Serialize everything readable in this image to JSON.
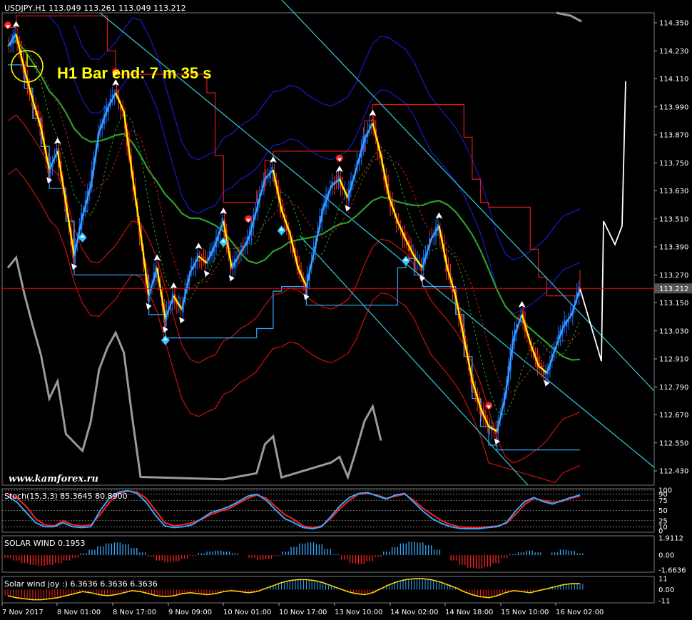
{
  "chart_title": "USDJPY,H1  113.049 113.261 113.049 113.212",
  "bar_end_label": "H1 Bar end: 7 m 35 s",
  "watermark": "www.kamforex.ru",
  "current_price_label": "113.212",
  "colors": {
    "background": "#000000",
    "up_candle": "#1e6fff",
    "down_candle": "#ff2a1a",
    "fast_line": "#ffff00",
    "mid_line": "#35a7ff",
    "green_ma": "#2ca02c",
    "envelope_blue": "#1a1acc",
    "envelope_red": "#cc1010",
    "trendline": "#33ccdd",
    "grey_band": "#9a9a9a",
    "current_price": "#ff0000",
    "histogram_pos": "#33aaff",
    "histogram_neg": "#ff2020"
  },
  "chart_data": [
    {
      "type": "line",
      "name_panel": "main",
      "ylim": [
        112.43,
        114.35
      ],
      "y_ticks": [
        "114.350",
        "114.230",
        "114.110",
        "113.990",
        "113.870",
        "113.750",
        "113.630",
        "113.510",
        "113.390",
        "113.270",
        "113.150",
        "113.030",
        "112.910",
        "112.790",
        "112.670",
        "112.550",
        "112.430"
      ],
      "current_price": 113.212,
      "x_ticks": [
        "7 Nov 2017",
        "8 Nov 01:00",
        "8 Nov 17:00",
        "9 Nov 09:00",
        "10 Nov 01:00",
        "10 Nov 17:00",
        "13 Nov 10:00",
        "14 Nov 02:00",
        "14 Nov 18:00",
        "15 Nov 10:00",
        "16 Nov 02:00"
      ],
      "price_path": [
        114.25,
        114.3,
        114.15,
        114.02,
        113.9,
        113.72,
        113.8,
        113.58,
        113.35,
        113.52,
        113.65,
        113.88,
        113.98,
        114.05,
        113.97,
        113.7,
        113.45,
        113.18,
        113.3,
        113.08,
        113.18,
        113.12,
        113.28,
        113.35,
        113.32,
        113.4,
        113.5,
        113.3,
        113.36,
        113.42,
        113.55,
        113.68,
        113.72,
        113.55,
        113.45,
        113.3,
        113.22,
        113.38,
        113.55,
        113.65,
        113.68,
        113.6,
        113.72,
        113.85,
        113.92,
        113.78,
        113.6,
        113.5,
        113.42,
        113.35,
        113.3,
        113.42,
        113.48,
        113.3,
        113.18,
        113.0,
        112.82,
        112.7,
        112.62,
        112.6,
        112.75,
        113.0,
        113.1,
        112.98,
        112.88,
        112.85,
        112.95,
        113.05,
        113.1,
        113.212
      ],
      "annotation": "www.kamforex.ru"
    },
    {
      "type": "line",
      "panel": "stochastic",
      "label": "Stoch(15,3,3) 85.3645 80.8900",
      "ylim": [
        0,
        100
      ],
      "y_ticks": [
        "100",
        "90",
        "75",
        "50",
        "25",
        "10",
        "0"
      ],
      "series": [
        {
          "color": "#ff2020",
          "values": [
            90,
            80,
            60,
            30,
            15,
            12,
            25,
            15,
            12,
            15,
            40,
            70,
            92,
            98,
            95,
            80,
            50,
            20,
            12,
            15,
            20,
            28,
            40,
            48,
            55,
            68,
            80,
            88,
            80,
            60,
            40,
            28,
            12,
            8,
            12,
            30,
            55,
            75,
            90,
            92,
            88,
            80,
            85,
            90,
            75,
            55,
            40,
            25,
            15,
            10,
            8,
            8,
            10,
            12,
            18,
            40,
            65,
            80,
            75,
            70,
            72,
            80,
            85
          ]
        },
        {
          "color": "#35a7ff",
          "values": [
            85,
            70,
            45,
            20,
            10,
            10,
            20,
            10,
            8,
            10,
            50,
            80,
            95,
            99,
            92,
            70,
            38,
            12,
            8,
            10,
            15,
            30,
            45,
            52,
            60,
            72,
            85,
            90,
            75,
            52,
            30,
            20,
            8,
            5,
            10,
            35,
            62,
            82,
            92,
            94,
            86,
            78,
            88,
            92,
            70,
            48,
            30,
            18,
            10,
            6,
            5,
            5,
            8,
            10,
            20,
            48,
            72,
            82,
            72,
            66,
            74,
            82,
            88
          ]
        }
      ]
    },
    {
      "type": "bar",
      "panel": "solar_wind",
      "label": "SOLAR WIND 0.1953",
      "ylim": [
        -1.6636,
        1.9112
      ],
      "y_ticks": [
        "1.9112",
        "0.00",
        "-1.6636"
      ],
      "values": [
        -0.3,
        -0.6,
        -0.9,
        -1.1,
        -1.2,
        -1.1,
        -0.9,
        -0.6,
        -0.3,
        0.2,
        0.6,
        1.0,
        1.3,
        1.4,
        1.2,
        0.8,
        0.3,
        -0.2,
        -0.6,
        -0.8,
        -0.7,
        -0.4,
        -0.1,
        0.2,
        0.4,
        0.5,
        0.4,
        0.2,
        0.0,
        -0.3,
        -0.5,
        -0.4,
        -0.1,
        0.4,
        0.9,
        1.3,
        1.4,
        1.2,
        0.7,
        0.1,
        -0.5,
        -0.9,
        -1.0,
        -0.7,
        -0.2,
        0.4,
        0.9,
        1.3,
        1.5,
        1.4,
        1.1,
        0.6,
        0.0,
        -0.6,
        -1.1,
        -1.4,
        -1.5,
        -1.3,
        -0.9,
        -0.3,
        0.1,
        0.3,
        0.5,
        0.3,
        0.0,
        0.3,
        0.6,
        0.5,
        0.2
      ]
    },
    {
      "type": "bar",
      "panel": "solar_wind_joy",
      "label": "Solar wind joy :) 6.3636 6.3636 6.3636",
      "ylim": [
        -11,
        11
      ],
      "y_ticks": [
        "11",
        "0.00",
        "-11"
      ],
      "values": [
        -6,
        -8,
        -9,
        -10,
        -10,
        -9,
        -8,
        -6,
        -4,
        -2,
        -3,
        -5,
        -6,
        -5,
        -3,
        -1,
        -2,
        -4,
        -6,
        -7,
        -6,
        -4,
        -3,
        -4,
        -5,
        -4,
        -2,
        -1,
        -2,
        -3,
        -2,
        1,
        4,
        7,
        9,
        10,
        10,
        9,
        7,
        4,
        1,
        -2,
        -4,
        -5,
        -3,
        1,
        5,
        8,
        10,
        11,
        11,
        10,
        8,
        5,
        2,
        -2,
        -5,
        -7,
        -8,
        -6,
        -3,
        -1,
        -2,
        -3,
        -1,
        1,
        3,
        5,
        6,
        6
      ]
    }
  ]
}
